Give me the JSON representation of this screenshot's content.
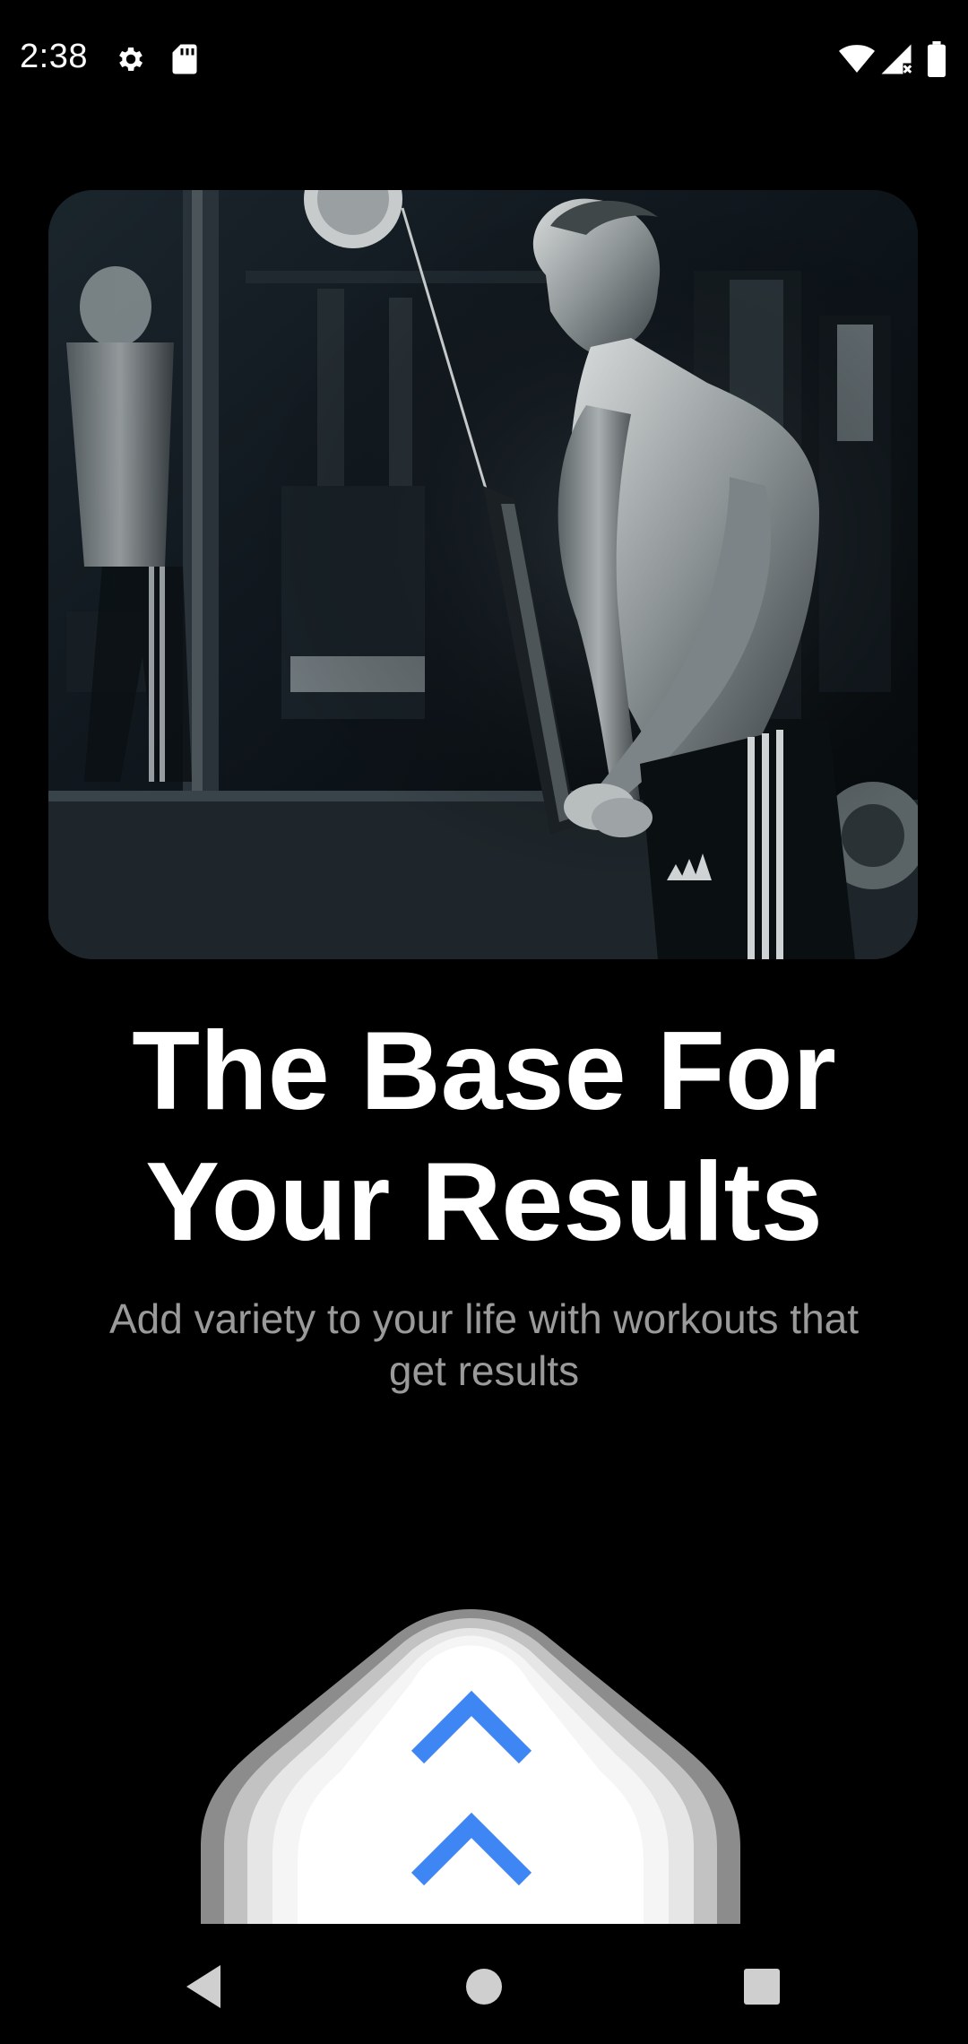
{
  "status_bar": {
    "time": "2:38",
    "icons_left": [
      "gear-icon",
      "sd-card-icon"
    ],
    "icons_right": [
      "wifi-icon",
      "signal-no-data-icon",
      "battery-icon"
    ]
  },
  "hero": {
    "image": "photo of man exercising with cable rope in dark gym"
  },
  "content": {
    "title_line1": "The Base For",
    "title_line2": "Your Results",
    "subtitle_line1": "Add variety to your life with workouts that",
    "subtitle_line2": "get results"
  },
  "swipe_control": {
    "icons": [
      "chevron-up-icon",
      "chevron-up-icon"
    ],
    "accent_color": "#3f86f5"
  },
  "nav_bar": {
    "buttons": [
      "back",
      "home",
      "recents"
    ]
  }
}
